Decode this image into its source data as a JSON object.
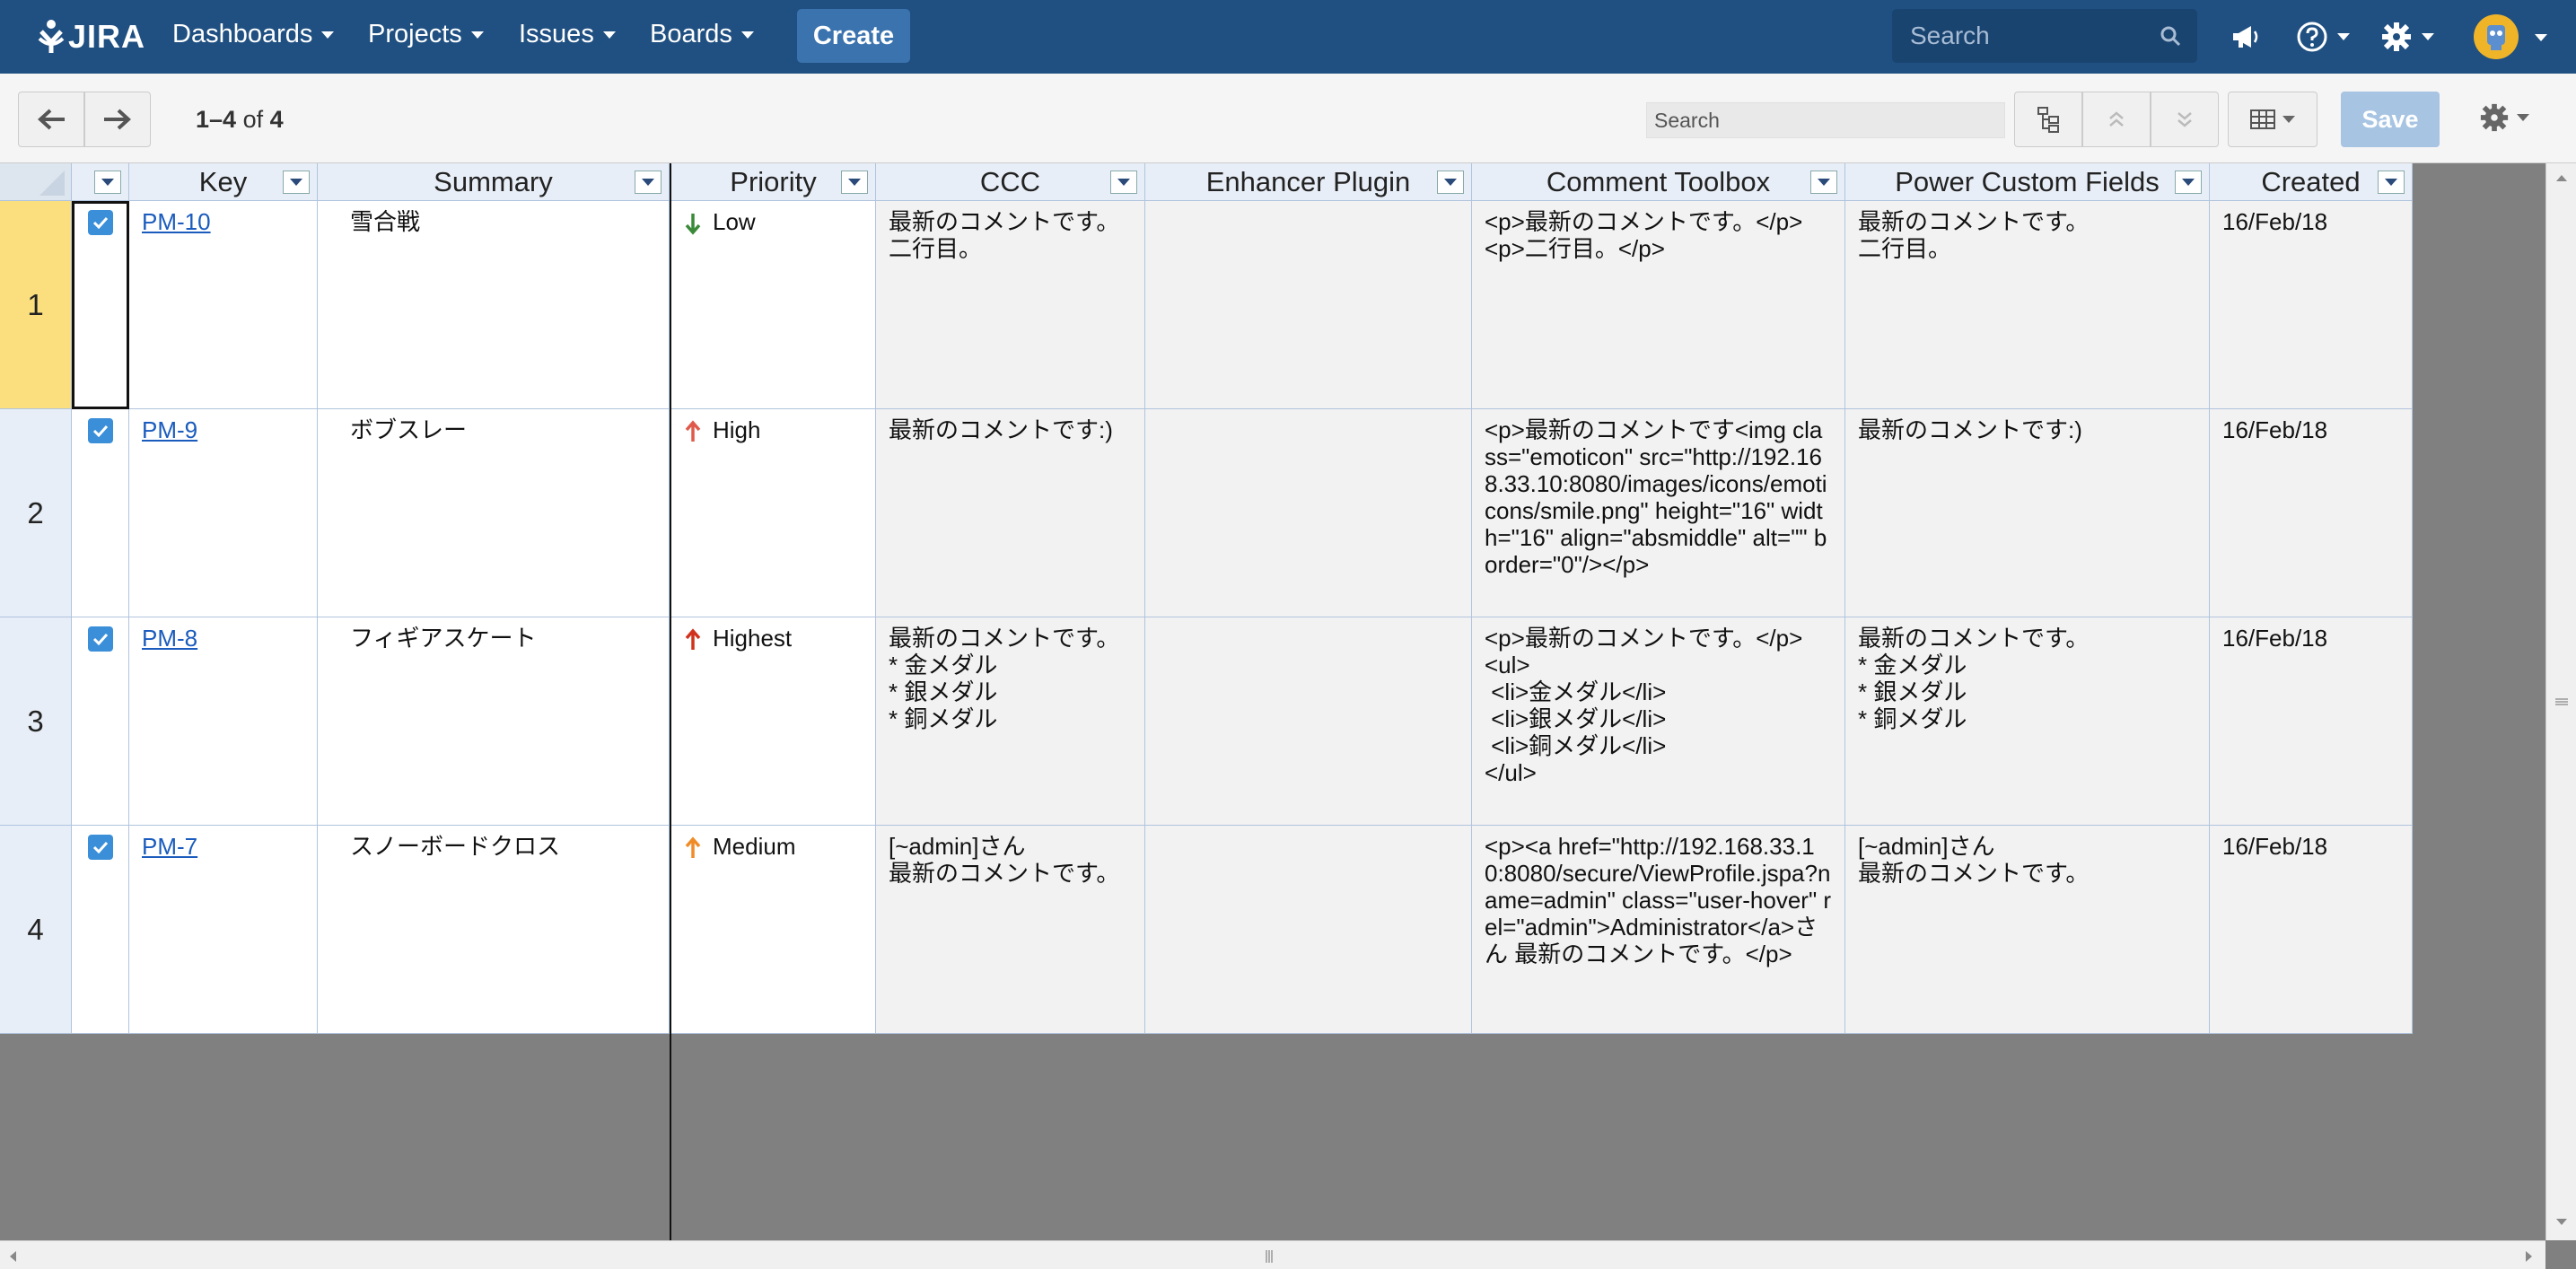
{
  "nav": {
    "logo": "JIRA",
    "items": [
      {
        "label": "Dashboards"
      },
      {
        "label": "Projects"
      },
      {
        "label": "Issues"
      },
      {
        "label": "Boards"
      }
    ],
    "create_label": "Create",
    "search_placeholder": "Search"
  },
  "toolbar": {
    "range": "1–4",
    "of_label": "of",
    "total": "4",
    "search_placeholder": "Search",
    "save_label": "Save"
  },
  "columns": [
    {
      "label": ""
    },
    {
      "label": "Key"
    },
    {
      "label": "Summary"
    },
    {
      "label": "Priority"
    },
    {
      "label": "CCC"
    },
    {
      "label": "Enhancer Plugin"
    },
    {
      "label": "Comment Toolbox"
    },
    {
      "label": "Power Custom Fields"
    },
    {
      "label": "Created"
    }
  ],
  "rows": [
    {
      "num": "1",
      "key": "PM-10",
      "summary": "雪合戦",
      "priority": "Low",
      "priority_color": "#3a8a3a",
      "priority_dir": "down",
      "ccc": "最新のコメントです。\n二行目。",
      "enhancer": "",
      "comment_toolbox": "<p>最新のコメントです。</p>\n<p>二行目。</p>",
      "power_custom": "最新のコメントです。\n二行目。",
      "created": "16/Feb/18"
    },
    {
      "num": "2",
      "key": "PM-9",
      "summary": "ボブスレー",
      "priority": "High",
      "priority_color": "#e05a4c",
      "priority_dir": "up",
      "ccc": "最新のコメントです:)",
      "enhancer": "",
      "comment_toolbox": "<p>最新のコメントです<img class=\"emoticon\" src=\"http://192.168.33.10:8080/images/icons/emoticons/smile.png\" height=\"16\" width=\"16\" align=\"absmiddle\" alt=\"\" border=\"0\"/></p>",
      "power_custom": "最新のコメントです:)",
      "created": "16/Feb/18"
    },
    {
      "num": "3",
      "key": "PM-8",
      "summary": "フィギアスケート",
      "priority": "Highest",
      "priority_color": "#d0321e",
      "priority_dir": "up",
      "ccc": "最新のコメントです。\n* 金メダル\n* 銀メダル\n* 銅メダル",
      "enhancer": "",
      "comment_toolbox": "<p>最新のコメントです。</p>\n<ul>\n <li>金メダル</li>\n <li>銀メダル</li>\n <li>銅メダル</li>\n</ul>",
      "power_custom": "最新のコメントです。\n* 金メダル\n* 銀メダル\n* 銅メダル",
      "created": "16/Feb/18"
    },
    {
      "num": "4",
      "key": "PM-7",
      "summary": "スノーボードクロス",
      "priority": "Medium",
      "priority_color": "#f08c28",
      "priority_dir": "up",
      "ccc": "[~admin]さん\n最新のコメントです。",
      "enhancer": "",
      "comment_toolbox": "<p><a href=\"http://192.168.33.10:8080/secure/ViewProfile.jspa?name=admin\" class=\"user-hover\" rel=\"admin\">Administrator</a>さん 最新のコメントです。</p>",
      "power_custom": "[~admin]さん\n最新のコメントです。",
      "created": "16/Feb/18"
    }
  ]
}
